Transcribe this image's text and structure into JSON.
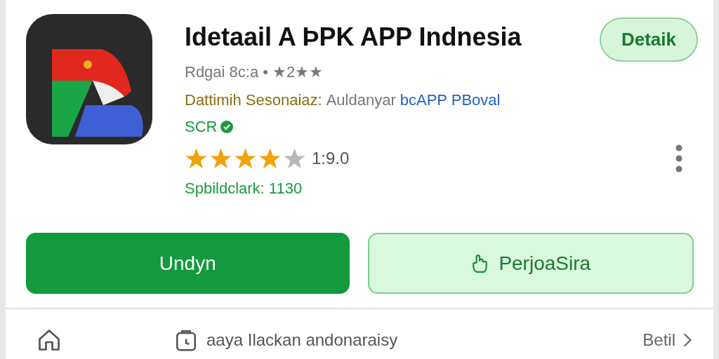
{
  "app": {
    "title": "Idetaail A ÞPK APP Indnesia",
    "meta": "Rdgai 8c:a • ★2★★",
    "developer_label": "Dattimih Sesonaiaz:",
    "developer_name": "Auldanyar",
    "developer_link": "bcAPP PBoval",
    "badge": "SCR",
    "verified": true,
    "stars": 4,
    "rating": "1:9.0",
    "size": "Spbildclark: 1130"
  },
  "detail_button": "Detaik",
  "buttons": [
    {
      "label": "Undyn",
      "kind": "primary"
    },
    {
      "label": "PerjoaSira",
      "kind": "secondary"
    }
  ],
  "bottom_bar": {
    "text": "aaya Ilackan andonaraisy",
    "link": "Betil"
  }
}
